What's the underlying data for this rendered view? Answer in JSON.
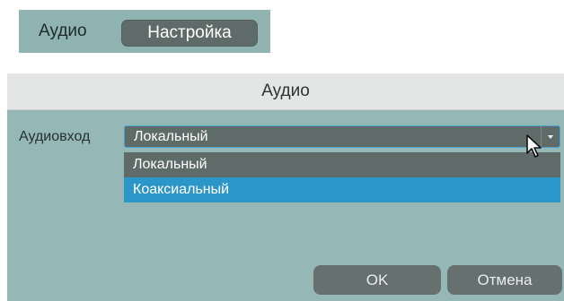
{
  "tabs": {
    "plain_label": "Аудио",
    "active_label": "Настройка"
  },
  "dialog": {
    "title": "Аудио",
    "field_label": "Аудиовход",
    "select_value": "Локальный",
    "options": [
      "Локальный",
      "Коаксиальный"
    ],
    "highlighted_option": "Коаксиальный",
    "ok_label": "OK",
    "cancel_label": "Отмена"
  },
  "colors": {
    "panel": "#95b8b6",
    "control": "#5f6b68",
    "highlight": "#2d96c9",
    "header": "#e4e6e6"
  },
  "icons": {
    "dropdown": "chevron-down-icon",
    "pointer": "mouse-pointer-icon"
  }
}
